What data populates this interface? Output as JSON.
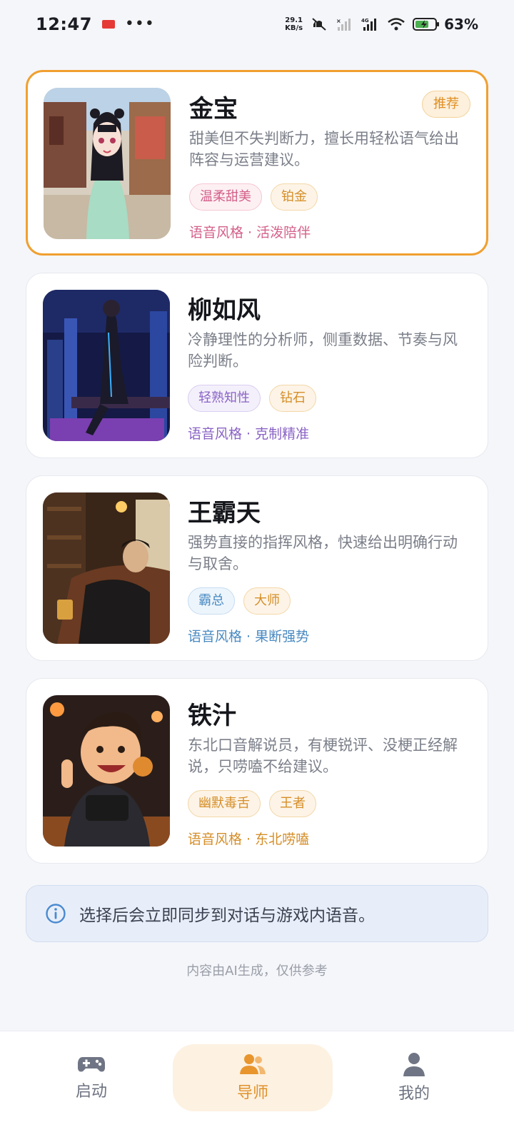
{
  "status_bar": {
    "time": "12:47",
    "app_badge": "头条",
    "more": "•••",
    "net_speed_value": "29.1",
    "net_speed_unit": "KB/s",
    "network": "4G",
    "battery": "63%",
    "icons": [
      "mute-icon",
      "signal-icon",
      "signal-icon",
      "wifi-icon",
      "battery-icon"
    ]
  },
  "advisors": [
    {
      "name": "金宝",
      "badge": "推荐",
      "desc": "甜美但不失判断力，擅长用轻松语气给出阵容与运营建议。",
      "tags": [
        "温柔甜美",
        "铂金"
      ],
      "voice": "语音风格 · 活泼陪伴",
      "selected": true
    },
    {
      "name": "柳如风",
      "desc": "冷静理性的分析师，侧重数据、节奏与风险判断。",
      "tags": [
        "轻熟知性",
        "钻石"
      ],
      "voice": "语音风格 · 克制精准"
    },
    {
      "name": "王霸天",
      "desc": "强势直接的指挥风格，快速给出明确行动与取舍。",
      "tags": [
        "霸总",
        "大师"
      ],
      "voice": "语音风格 · 果断强势"
    },
    {
      "name": "铁汁",
      "desc": "东北口音解说员，有梗锐评、没梗正经解说，只唠嗑不给建议。",
      "tags": [
        "幽默毒舌",
        "王者"
      ],
      "voice": "语音风格 · 东北唠嗑"
    }
  ],
  "info": {
    "icon": "info-icon",
    "text": "选择后会立即同步到对话与游戏内语音。"
  },
  "disclaimer": "内容由AI生成，仅供参考",
  "tabs": [
    {
      "label": "启动",
      "icon": "gamepad-icon"
    },
    {
      "label": "导师",
      "icon": "users-icon",
      "active": true
    },
    {
      "label": "我的",
      "icon": "user-icon"
    }
  ],
  "colors": {
    "accent": "#f0a030",
    "background": "#f5f6fa"
  }
}
